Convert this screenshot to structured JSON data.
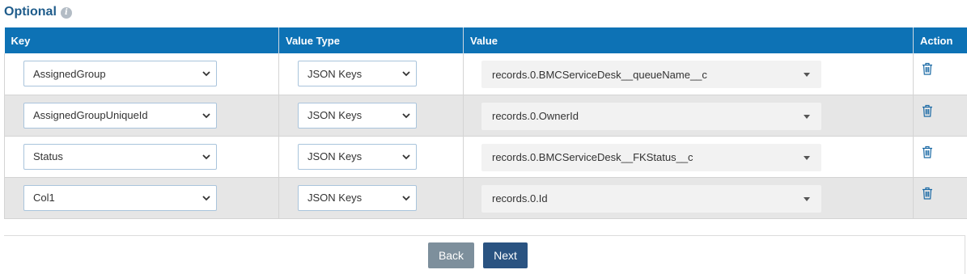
{
  "section": {
    "title": "Optional",
    "info_icon": "info-icon"
  },
  "table": {
    "headers": {
      "key": "Key",
      "value_type": "Value Type",
      "value": "Value",
      "action": "Action"
    },
    "rows": [
      {
        "key": "AssignedGroup",
        "value_type": "JSON Keys",
        "value": "records.0.BMCServiceDesk__queueName__c",
        "action_icon": "trash-icon"
      },
      {
        "key": "AssignedGroupUniqueId",
        "value_type": "JSON Keys",
        "value": "records.0.OwnerId",
        "action_icon": "trash-icon"
      },
      {
        "key": "Status",
        "value_type": "JSON Keys",
        "value": "records.0.BMCServiceDesk__FKStatus__c",
        "action_icon": "trash-icon"
      },
      {
        "key": "Col1",
        "value_type": "JSON Keys",
        "value": "records.0.Id",
        "action_icon": "trash-icon"
      }
    ]
  },
  "buttons": {
    "back": "Back",
    "next": "Next"
  },
  "colors": {
    "header_bg": "#0d72b5",
    "title": "#1f5c8b",
    "row_alt_bg": "#e6e6e6",
    "back_button": "#7d8f9c",
    "next_button": "#2a5381"
  }
}
